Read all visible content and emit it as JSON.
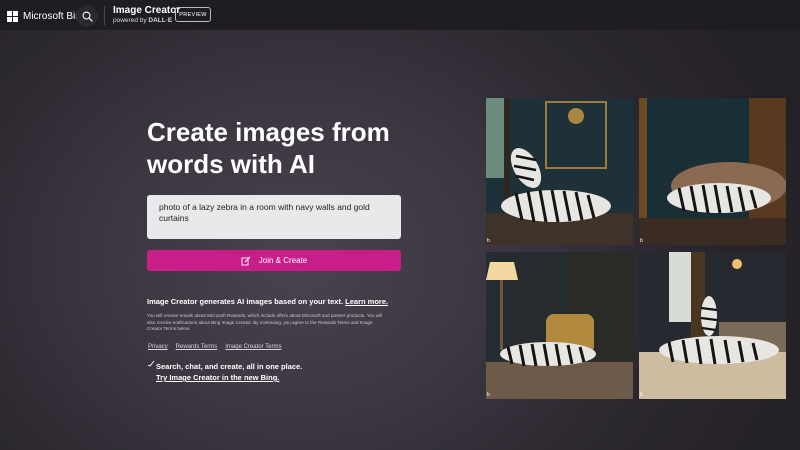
{
  "header": {
    "brand": "Microsoft Bing",
    "product_title": "Image Creator",
    "powered_prefix": "powered by",
    "powered_name": "DALL·E",
    "badge": "PREVIEW"
  },
  "main": {
    "headline": "Create images from words with AI",
    "prompt_value": "photo of a lazy zebra in a room with navy walls and gold curtains",
    "create_button": "Join & Create",
    "description": "Image Creator generates AI images based on your text.",
    "learn_more": "Learn more.",
    "fine_print": "You will receive emails about Microsoft Rewards, which include offers about Microsoft and partner products. You will also receive notifications about Bing Image Creator. By continuing, you agree to the Rewards Terms and Image Creator Terms below.",
    "links": [
      "Privacy",
      "Rewards Terms",
      "Image Creator Terms"
    ],
    "promo_line1": "Search, chat, and create, all in one place.",
    "promo_line2": "Try Image Creator in the new Bing."
  },
  "gallery": {
    "tag": "b",
    "images": [
      {
        "description": "zebra lying by navy paneled wall with gold frame"
      },
      {
        "description": "zebra lying on sofa near gold curtain"
      },
      {
        "description": "zebra on floor with lamp and gold armchair"
      },
      {
        "description": "zebra lying on bed by window"
      }
    ]
  },
  "colors": {
    "accent": "#c81e8a",
    "header_bg": "#1f1d21",
    "prompt_bg": "#e9e8ea"
  }
}
